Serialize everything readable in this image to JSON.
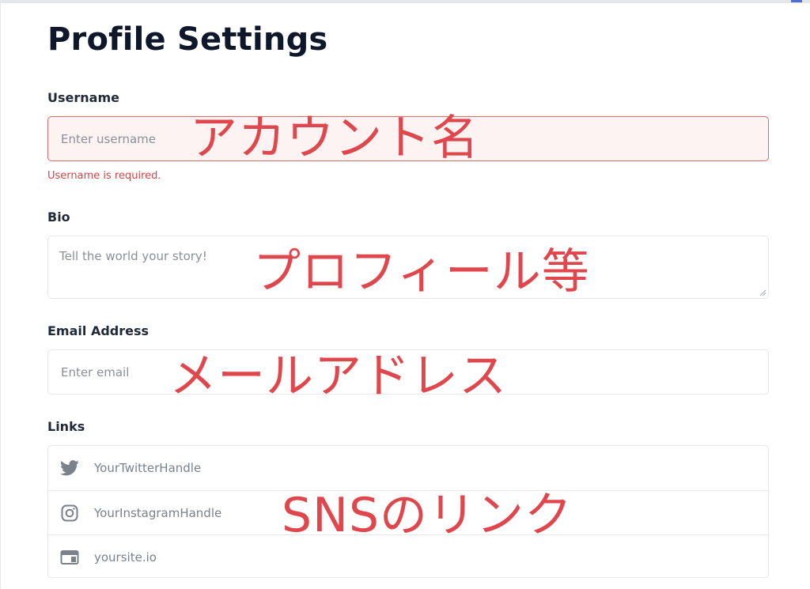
{
  "page": {
    "title": "Profile Settings"
  },
  "form": {
    "username": {
      "label": "Username",
      "placeholder": "Enter username",
      "value": "",
      "error": "Username is required."
    },
    "bio": {
      "label": "Bio",
      "placeholder": "Tell the world your story!",
      "value": ""
    },
    "email": {
      "label": "Email Address",
      "placeholder": "Enter email",
      "value": ""
    },
    "links": {
      "label": "Links",
      "items": [
        {
          "icon": "twitter-icon",
          "placeholder": "YourTwitterHandle",
          "value": ""
        },
        {
          "icon": "instagram-icon",
          "placeholder": "YourInstagramHandle",
          "value": ""
        },
        {
          "icon": "website-icon",
          "placeholder": "yoursite.io",
          "value": ""
        }
      ]
    }
  },
  "annotations": {
    "username": "アカウント名",
    "bio": "プロフィール等",
    "email": "メールアドレス",
    "links": "SNSのリンク"
  },
  "colors": {
    "annotation": "#e0474c",
    "error": "#d64545",
    "error_border": "#dc6b6b",
    "error_background": "#fdf3f3",
    "icon": "#7b8189"
  }
}
